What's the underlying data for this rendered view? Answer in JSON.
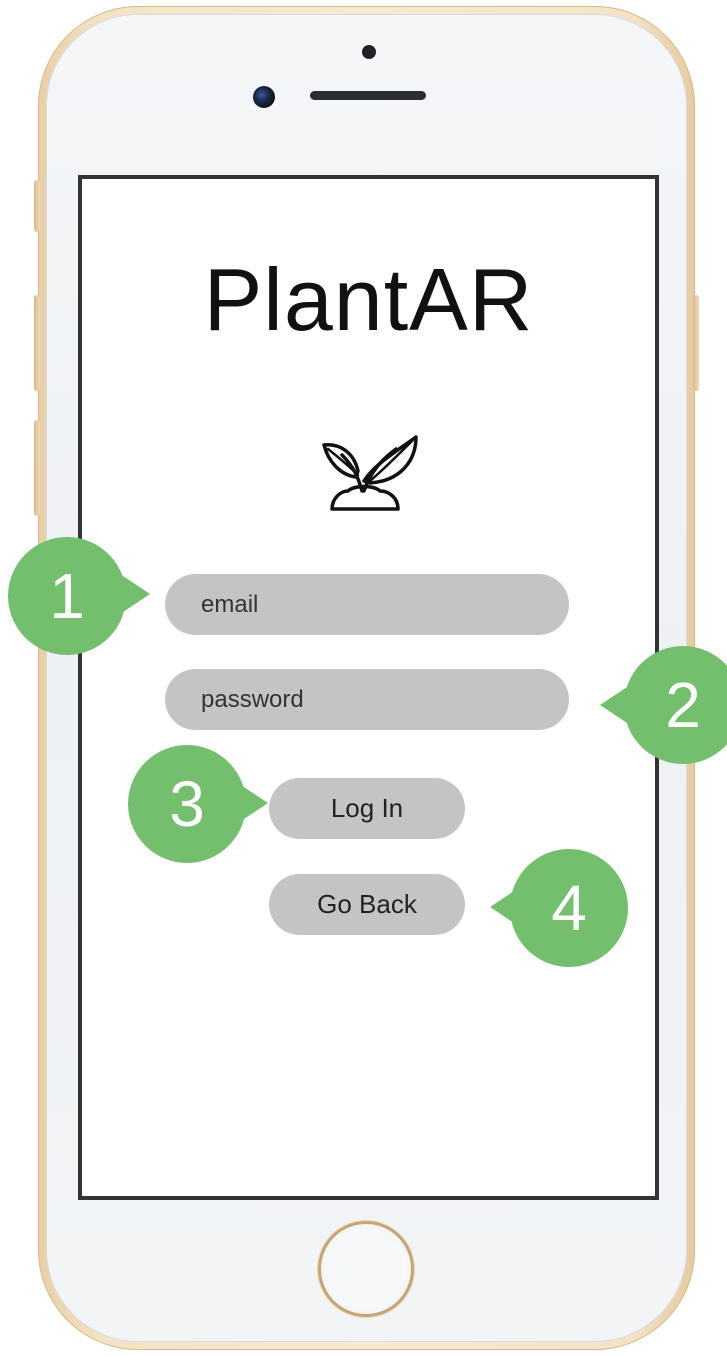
{
  "app": {
    "title": "PlantAR"
  },
  "icons": {
    "logo": "sprout-icon"
  },
  "login": {
    "email_placeholder": "email",
    "password_placeholder": "password",
    "login_label": "Log In",
    "back_label": "Go Back"
  },
  "annotations": {
    "email": "1",
    "password": "2",
    "login": "3",
    "back": "4"
  },
  "colors": {
    "badge": "#73bf6e",
    "field": "#c4c4c4",
    "screen_border": "#333333"
  }
}
